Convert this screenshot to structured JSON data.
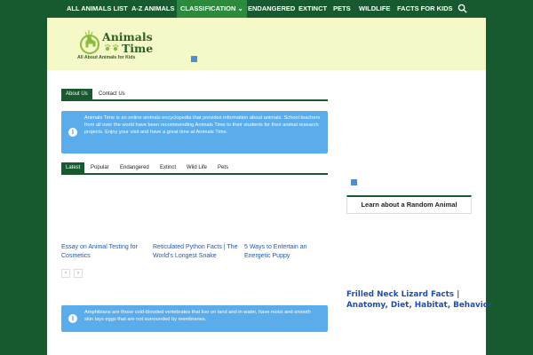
{
  "nav": {
    "items": [
      {
        "label": "ALL ANIMALS LIST"
      },
      {
        "label": "A-Z ANIMALS"
      },
      {
        "label": "CLASSIFICATION ⌄"
      },
      {
        "label": "ENDANGERED"
      },
      {
        "label": "EXTINCT"
      },
      {
        "label": "PETS"
      },
      {
        "label": "WILDLIFE"
      },
      {
        "label": "FACTS FOR KIDS"
      }
    ],
    "active_index": 2
  },
  "logo": {
    "title_line1": "Animals",
    "title_line2": "Time",
    "tagline": "All About Animals for Kids"
  },
  "about_tabs": {
    "tabs": [
      "About Us",
      "Contact Us"
    ],
    "active": 0
  },
  "about_text": "Animals Time is an online animals encyclopedia that provides information about animals. School teachers from all over the world have been recommending Animals Time to their students for their animal research projects. Enjoy your visit and have a great time at Animals Time.",
  "post_tabs": {
    "tabs": [
      "Latest",
      "Popular",
      "Endangered",
      "Extinct",
      "Wild Life",
      "Pets"
    ],
    "active": 0
  },
  "posts": [
    {
      "title": "Essay on Animal Testing for Cosmetics"
    },
    {
      "title": "Reticulated Python Facts | The World's Longest Snake"
    },
    {
      "title": "5 Ways to Entertain an Energetic Puppy"
    }
  ],
  "pager": {
    "prev": "‹",
    "next": "›"
  },
  "amphibian_text": "Amphibians are those cold-blooded vertebrates that live on land and in water, have moist and smooth skin lays eggs that are not surrounded by membranes.",
  "sidebar": {
    "random_button": "Learn about a Random Animal",
    "featured_title_line1": "Frilled Neck Lizard Facts |",
    "featured_title_line2": "Anatomy, Diet, Habitat, Behavior"
  },
  "colors": {
    "brand_green": "#175a2f",
    "header_bg": "#f4f9c7",
    "info_blue": "#5aacea",
    "link_blue": "#1e58b4"
  }
}
